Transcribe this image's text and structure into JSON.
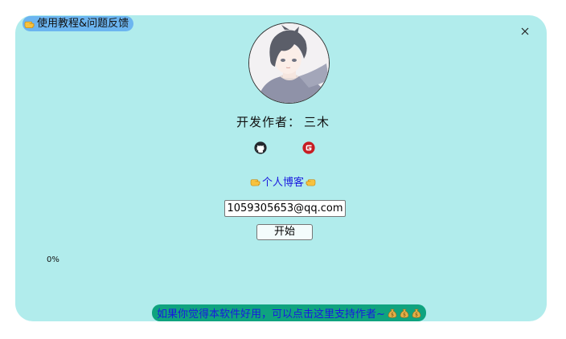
{
  "help": {
    "label": "使用教程&问题反馈",
    "icon": "pointing-hand-icon"
  },
  "close": {
    "icon": "close-icon"
  },
  "author": {
    "label": "开发作者：",
    "name": "三木"
  },
  "links": {
    "github_icon": "github-icon",
    "gitee_icon": "gitee-icon",
    "blog_label": "个人博客"
  },
  "form": {
    "email_value": "1059305653@qq.com",
    "start_label": "开始"
  },
  "progress": {
    "text": "0%",
    "value": 0
  },
  "support": {
    "label": "如果你觉得本软件好用，可以点击这里支持作者~"
  },
  "colors": {
    "panel": "#b1ecec",
    "help_pill": "#6cb5f0",
    "support_pill": "#0fa37f",
    "link": "#1a1adf"
  }
}
